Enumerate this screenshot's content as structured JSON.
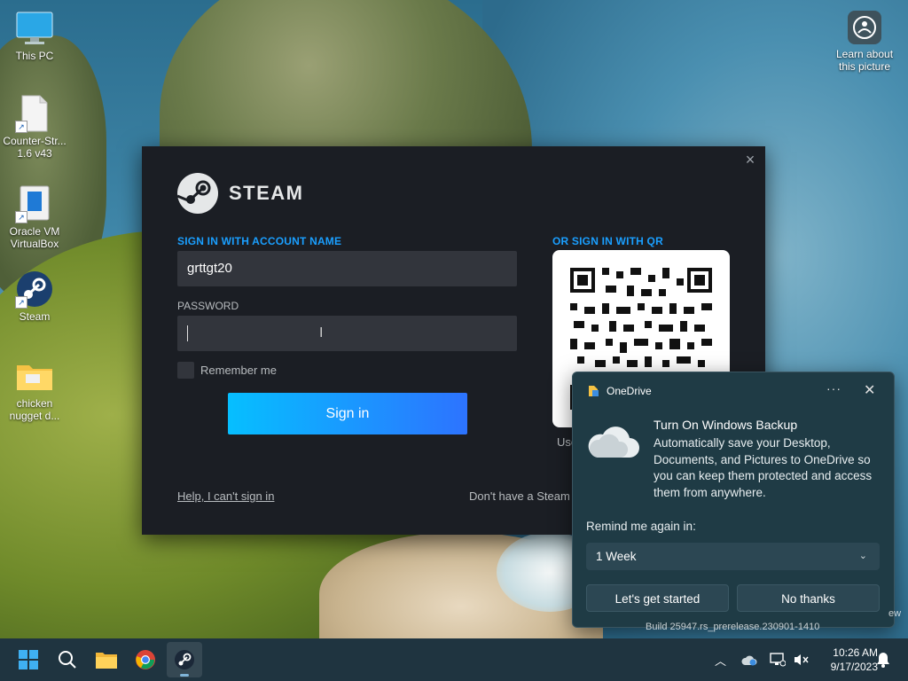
{
  "desktop": {
    "icons": [
      {
        "label": "This PC"
      },
      {
        "label": "Counter-Str... 1.6 v43"
      },
      {
        "label": "Oracle VM VirtualBox"
      },
      {
        "label": "Steam"
      },
      {
        "label": "chicken nugget d..."
      }
    ],
    "learn_picture": "Learn about this picture"
  },
  "steam": {
    "logo_text": "STEAM",
    "signin_name_label": "SIGN IN WITH ACCOUNT NAME",
    "account_name_value": "grttgt20",
    "password_label": "PASSWORD",
    "password_value": "",
    "remember_label": "Remember me",
    "signin_button": "Sign in",
    "help_link": "Help, I can't sign in",
    "no_account_text": "Don't have a Steam a",
    "qr_label": "OR SIGN IN WITH QR",
    "qr_use_text": "Use"
  },
  "onedrive_toast": {
    "app_name": "OneDrive",
    "title": "Turn On Windows Backup",
    "body": "Automatically save your Desktop, Documents, and Pictures to OneDrive so you can keep them protected and access them from anywhere.",
    "remind_label": "Remind me again in:",
    "remind_value": "1 Week",
    "primary_button": "Let's get started",
    "secondary_button": "No thanks"
  },
  "watermark": {
    "line1": "ew",
    "line2": "Build 25947.rs_prerelease.230901-1410"
  },
  "taskbar": {
    "time": "10:26 AM",
    "date": "9/17/2023"
  },
  "colors": {
    "steam_accent": "#1a9fff",
    "steam_button_start": "#06bfff",
    "steam_button_end": "#2d73ff",
    "toast_bg": "#1f3b45",
    "taskbar_bg": "#1f3440"
  }
}
